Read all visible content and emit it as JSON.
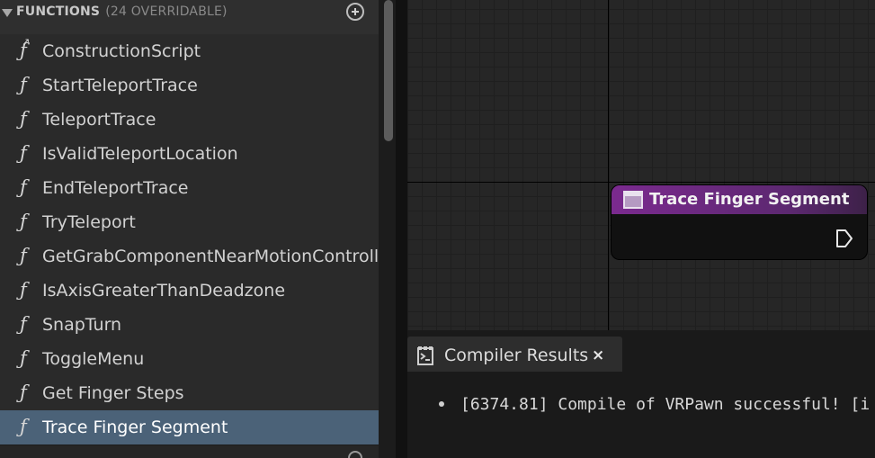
{
  "functions_panel": {
    "title": "FUNCTIONS",
    "count": "(24 OVERRIDABLE)",
    "items": [
      {
        "label": "ConstructionScript",
        "icon": "construction-script-icon"
      },
      {
        "label": "StartTeleportTrace",
        "icon": "function-icon"
      },
      {
        "label": "TeleportTrace",
        "icon": "function-icon"
      },
      {
        "label": "IsValidTeleportLocation",
        "icon": "function-icon"
      },
      {
        "label": "EndTeleportTrace",
        "icon": "function-icon"
      },
      {
        "label": "TryTeleport",
        "icon": "function-icon"
      },
      {
        "label": "GetGrabComponentNearMotionController",
        "icon": "function-icon"
      },
      {
        "label": "IsAxisGreaterThanDeadzone",
        "icon": "function-icon"
      },
      {
        "label": "SnapTurn",
        "icon": "function-icon"
      },
      {
        "label": "ToggleMenu",
        "icon": "function-icon"
      },
      {
        "label": "Get Finger Steps",
        "icon": "function-icon"
      },
      {
        "label": "Trace Finger Segment",
        "icon": "function-icon",
        "selected": true
      }
    ],
    "function_glyph": "ƒ"
  },
  "graph": {
    "node": {
      "title": "Trace Finger Segment",
      "header_color": "#7b2a8f"
    }
  },
  "compiler_results": {
    "tab_label": "Compiler Results",
    "close_glyph": "×",
    "lines": [
      "[6374.81] Compile of VRPawn successful! [i"
    ]
  },
  "colors": {
    "selection": "#4b6278",
    "panel_bg": "#2a2a2a",
    "graph_bg": "#262626"
  }
}
